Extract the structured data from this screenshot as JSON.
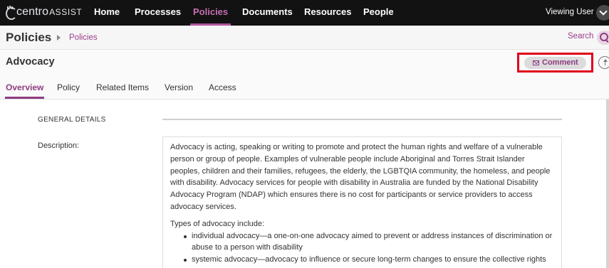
{
  "app": {
    "logo_text_prefix": "centro",
    "logo_text_suffix": "ASSIST"
  },
  "nav": {
    "items": [
      "Home",
      "Processes",
      "Policies",
      "Documents",
      "Resources",
      "People"
    ],
    "active": "Policies",
    "user_label": "Viewing User"
  },
  "breadcrumb": {
    "title": "Policies",
    "link": "Policies",
    "search_label": "Search"
  },
  "header": {
    "title": "Advocacy",
    "comment_label": "Comment"
  },
  "tabs": {
    "items": [
      "Overview",
      "Policy",
      "Related Items",
      "Version",
      "Access"
    ],
    "active": "Overview"
  },
  "details": {
    "section_heading": "GENERAL DETAILS",
    "description_label": "Description:",
    "description_paragraph": "Advocacy is acting, speaking or writing to promote and protect the human rights and welfare of a vulnerable person or group of people. Examples of vulnerable people include Aboriginal and Torres Strait Islander peoples, children and their families, refugees, the elderly, the LGBTQIA community, the homeless, and people with disability. Advocacy services for people with disability in Australia are funded by the National Disability Advocacy Program (NDAP) which ensures there is no cost for participants or service providers to access advocacy services.",
    "types_intro": "Types of advocacy include:",
    "types": [
      "individual advocacy—a one-on-one advocacy aimed to prevent or address instances of discrimination or abuse to a person with disability",
      "systemic advocacy—advocacy to influence or secure long-term changes to ensure the collective rights and interests of people with disability"
    ]
  },
  "colors": {
    "nav_background": "#121212",
    "accent": "#8e3c80",
    "active_nav": "#c86fb3",
    "highlight_box": "#e0001b"
  }
}
